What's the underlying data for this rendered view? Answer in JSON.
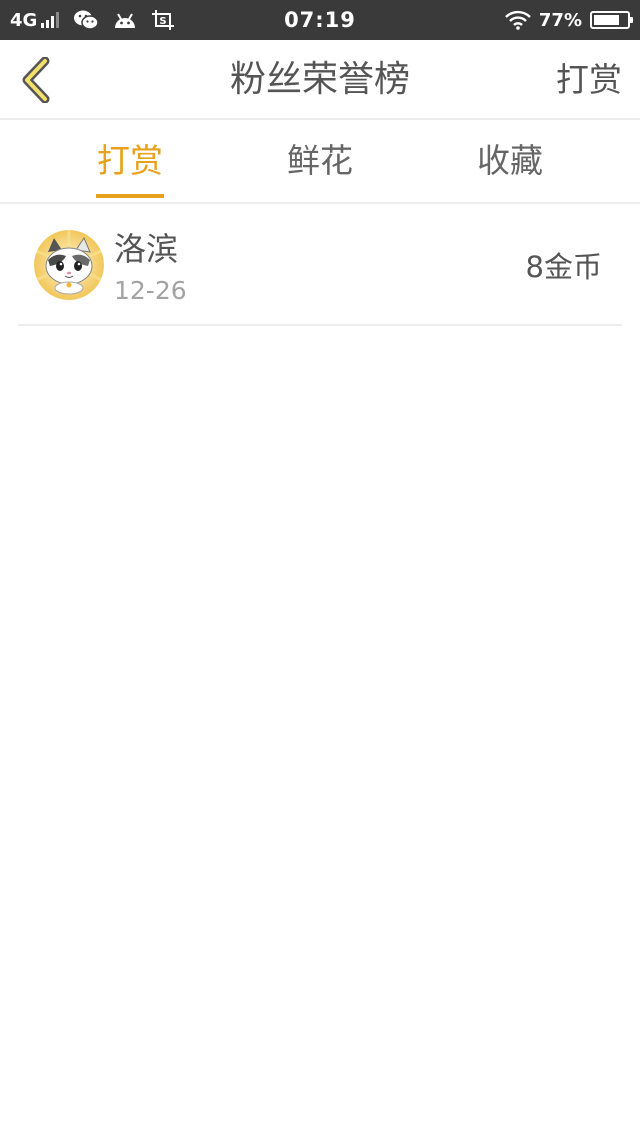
{
  "status_bar": {
    "network": "4G",
    "time": "07:19",
    "battery": "77%",
    "battery_level": 0.77,
    "icons": [
      "signal-icon",
      "wechat-icon",
      "android-icon",
      "screenshot-icon",
      "wifi-icon",
      "battery-icon"
    ]
  },
  "header": {
    "title": "粉丝荣誉榜",
    "action_label": "打赏",
    "back_icon": "chevron-left-icon"
  },
  "tabs": [
    {
      "label": "打赏",
      "active": true
    },
    {
      "label": "鲜花",
      "active": false
    },
    {
      "label": "收藏",
      "active": false
    }
  ],
  "list": [
    {
      "name": "洛滨",
      "date": "12-26",
      "amount": "8金币",
      "avatar_icon": "cat-avatar"
    }
  ],
  "colors": {
    "accent": "#e8a21a",
    "status_bar": "#3a3a3a",
    "text": "#555555",
    "muted": "#a3a3a3",
    "divider": "#ececec"
  }
}
